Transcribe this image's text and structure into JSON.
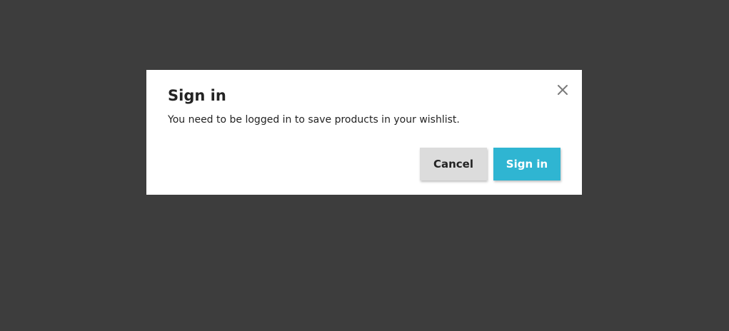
{
  "modal": {
    "title": "Sign in",
    "message": "You need to be logged in to save products in your wishlist.",
    "close_icon": "close-icon",
    "cancel_label": "Cancel",
    "signin_label": "Sign in"
  },
  "colors": {
    "backdrop": "#3d3d3d",
    "modal_background": "#ffffff",
    "text": "#232323",
    "cancel_background": "#dcdcdc",
    "primary": "#2fb5d2",
    "close_icon": "#7a7a7a"
  }
}
